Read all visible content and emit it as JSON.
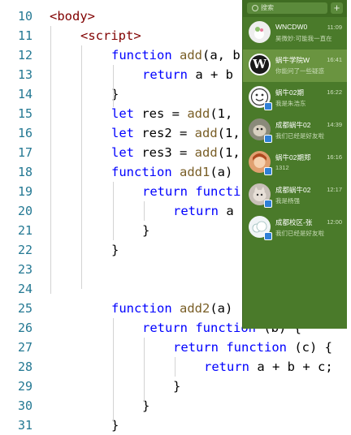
{
  "editor": {
    "lines": [
      {
        "num": "10",
        "parts": [
          [
            "tag",
            "<body>"
          ]
        ]
      },
      {
        "num": "11",
        "parts": [
          [
            "tag",
            "<script>"
          ]
        ]
      },
      {
        "num": "12",
        "parts": [
          [
            "kw",
            "function "
          ],
          [
            "fn",
            "add"
          ],
          [
            "",
            "(a, b"
          ]
        ]
      },
      {
        "num": "13",
        "parts": [
          [
            "kw",
            "return "
          ],
          [
            "",
            "a + b"
          ]
        ]
      },
      {
        "num": "14",
        "parts": [
          [
            "",
            "}"
          ]
        ]
      },
      {
        "num": "15",
        "parts": [
          [
            "kw",
            "let "
          ],
          [
            "",
            "res = "
          ],
          [
            "fn",
            "add"
          ],
          [
            "",
            "(1,"
          ]
        ]
      },
      {
        "num": "16",
        "parts": [
          [
            "kw",
            "let "
          ],
          [
            "",
            "res2 = "
          ],
          [
            "fn",
            "add"
          ],
          [
            "",
            "(1,"
          ]
        ]
      },
      {
        "num": "17",
        "parts": [
          [
            "kw",
            "let "
          ],
          [
            "",
            "res3 = "
          ],
          [
            "fn",
            "add"
          ],
          [
            "",
            "(1,"
          ]
        ]
      },
      {
        "num": "18",
        "parts": [
          [
            "kw",
            "function "
          ],
          [
            "fn",
            "add1"
          ],
          [
            "",
            "(a)"
          ]
        ]
      },
      {
        "num": "19",
        "parts": [
          [
            "kw",
            "return "
          ],
          [
            "kw",
            "functi"
          ]
        ]
      },
      {
        "num": "20",
        "parts": [
          [
            "kw",
            "return "
          ],
          [
            "",
            "a"
          ]
        ]
      },
      {
        "num": "21",
        "parts": [
          [
            "",
            "}"
          ]
        ]
      },
      {
        "num": "22",
        "parts": [
          [
            "",
            "}"
          ]
        ]
      },
      {
        "num": "23",
        "parts": []
      },
      {
        "num": "24",
        "parts": []
      },
      {
        "num": "25",
        "parts": [
          [
            "kw",
            "function "
          ],
          [
            "fn",
            "add2"
          ],
          [
            "",
            "(a)"
          ]
        ]
      },
      {
        "num": "26",
        "parts": [
          [
            "kw",
            "return "
          ],
          [
            "kw",
            "function "
          ],
          [
            "",
            "(b) {"
          ]
        ]
      },
      {
        "num": "27",
        "parts": [
          [
            "kw",
            "return "
          ],
          [
            "kw",
            "function "
          ],
          [
            "",
            "(c) {"
          ]
        ]
      },
      {
        "num": "28",
        "parts": [
          [
            "kw",
            "return "
          ],
          [
            "",
            "a + b + c;"
          ]
        ]
      },
      {
        "num": "29",
        "parts": [
          [
            "",
            "}"
          ]
        ]
      },
      {
        "num": "30",
        "parts": [
          [
            "",
            "}"
          ]
        ]
      },
      {
        "num": "31",
        "parts": [
          [
            "",
            "}"
          ]
        ]
      }
    ]
  },
  "chat_panel": {
    "search_placeholder": "搜索",
    "add_label": "+",
    "chats": [
      {
        "name": "WNCDW0",
        "time": "11:09",
        "preview": "昊微妙:可能我一直在"
      },
      {
        "name": "蜗牛学院W",
        "time": "16:41",
        "preview": "你能问了一些疑惑"
      },
      {
        "name": "蜗牛02期",
        "time": "16:22",
        "preview": "我是朱浩东"
      },
      {
        "name": "成都蜗牛02",
        "time": "14:39",
        "preview": "我们已经是好友啦"
      },
      {
        "name": "蜗牛02期郑",
        "time": "16:16",
        "preview": "1312"
      },
      {
        "name": "成都蜗牛02",
        "time": "12:17",
        "preview": "我是杨强"
      },
      {
        "name": "成都校区-张",
        "time": "12:00",
        "preview": "我们已经是好友啦"
      }
    ]
  }
}
